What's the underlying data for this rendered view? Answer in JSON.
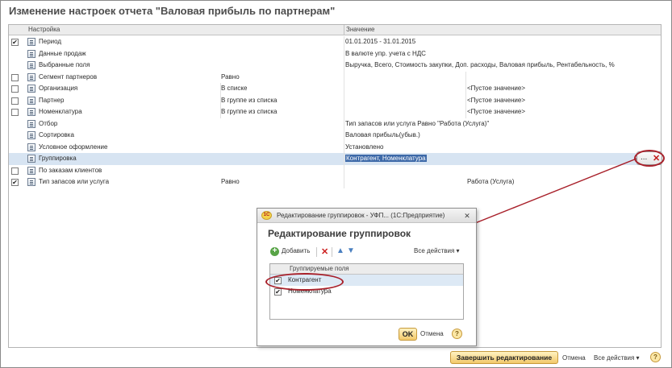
{
  "page": {
    "title": "Изменение настроек отчета \"Валовая прибыль по партнерам\""
  },
  "settings_table": {
    "col_setting": "Настройка",
    "col_value": "Значение",
    "rows": [
      {
        "checkbox": true,
        "checked": true,
        "name": "Период",
        "cond": "",
        "value": "01.01.2015 - 31.01.2015",
        "value2": ""
      },
      {
        "checkbox": false,
        "checked": false,
        "name": "Данные продаж",
        "cond": "",
        "value": "В валюте упр. учета с НДС",
        "value2": ""
      },
      {
        "checkbox": false,
        "checked": false,
        "name": "Выбранные поля",
        "cond": "",
        "value": "Выручка, Всего, Стоимость закупки, Доп. расходы, Валовая прибыль, Рентабельность, %",
        "value2": ""
      },
      {
        "checkbox": true,
        "checked": false,
        "name": "Сегмент партнеров",
        "cond": "Равно",
        "value": "",
        "value2": ""
      },
      {
        "checkbox": true,
        "checked": false,
        "name": "Организация",
        "cond": "В списке",
        "value": "",
        "value2": "<Пустое значение>"
      },
      {
        "checkbox": true,
        "checked": false,
        "name": "Партнер",
        "cond": "В группе из списка",
        "value": "",
        "value2": "<Пустое значение>"
      },
      {
        "checkbox": true,
        "checked": false,
        "name": "Номенклатура",
        "cond": "В группе из списка",
        "value": "",
        "value2": "<Пустое значение>"
      },
      {
        "checkbox": false,
        "checked": false,
        "name": "Отбор",
        "cond": "",
        "value": "Тип запасов или услуга Равно \"Работа (Услуга)\"",
        "value2": ""
      },
      {
        "checkbox": false,
        "checked": false,
        "name": "Сортировка",
        "cond": "",
        "value": "Валовая прибыль(убыв.)",
        "value2": ""
      },
      {
        "checkbox": false,
        "checked": false,
        "name": "Условное оформление",
        "cond": "",
        "value": "Установлено",
        "value2": ""
      },
      {
        "checkbox": false,
        "checked": false,
        "name": "Группировка",
        "cond": "",
        "value": "Контрагент, Номенклатура",
        "value2": ""
      },
      {
        "checkbox": true,
        "checked": false,
        "name": "По заказам клиентов",
        "cond": "",
        "value": "",
        "value2": ""
      },
      {
        "checkbox": true,
        "checked": true,
        "name": "Тип запасов или услуга",
        "cond": "Равно",
        "value": "",
        "value2": "Работа (Услуга)"
      }
    ],
    "selected_row": 10,
    "cell_buttons": {
      "select": "...",
      "clear": "✕"
    }
  },
  "dialog": {
    "title": "Редактирование группировок - УФП... (1С:Предприятие)",
    "heading": "Редактирование группировок",
    "logo": "1С",
    "toolbar": {
      "add": "Добавить",
      "all_actions": "Все действия"
    },
    "list_header": "Группируемые поля",
    "items": [
      {
        "name": "Контрагент",
        "checked": true
      },
      {
        "name": "Номенклатура",
        "checked": true
      }
    ],
    "ok": "OK",
    "cancel": "Отмена",
    "help": "?"
  },
  "footer": {
    "finish": "Завершить редактирование",
    "cancel": "Отмена",
    "all_actions": "Все действия",
    "help": "?"
  },
  "colors": {
    "accent": "#c87a0c",
    "annotation": "#a8202a",
    "selection": "#3d69a8"
  }
}
